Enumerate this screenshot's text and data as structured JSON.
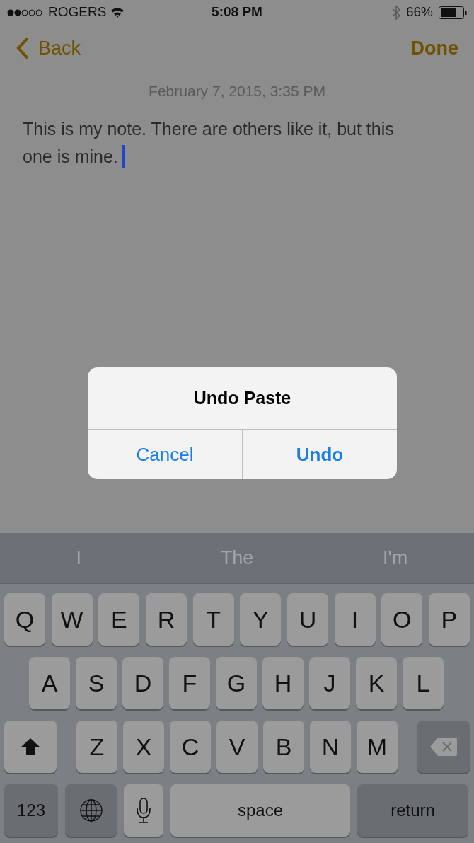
{
  "status_bar": {
    "carrier": "ROGERS",
    "time": "5:08 PM",
    "battery": "66%"
  },
  "nav": {
    "back": "Back",
    "done": "Done"
  },
  "note": {
    "date": "February 7, 2015, 3:35 PM",
    "lines": [
      "This is my note. There are others like it, but this",
      "one is mine."
    ]
  },
  "alert": {
    "title": "Undo Paste",
    "buttons": [
      {
        "label": "Cancel",
        "primary": false
      },
      {
        "label": "Undo",
        "primary": true
      }
    ]
  },
  "suggestions": [
    "I",
    "The",
    "I'm"
  ],
  "keyboard": {
    "rows": [
      {
        "keys": [
          {
            "kind": "letter",
            "label": "Q"
          },
          {
            "kind": "letter",
            "label": "W"
          },
          {
            "kind": "letter",
            "label": "E"
          },
          {
            "kind": "letter",
            "label": "R"
          },
          {
            "kind": "letter",
            "label": "T"
          },
          {
            "kind": "letter",
            "label": "Y"
          },
          {
            "kind": "letter",
            "label": "U"
          },
          {
            "kind": "letter",
            "label": "I"
          },
          {
            "kind": "letter",
            "label": "O"
          },
          {
            "kind": "letter",
            "label": "P"
          }
        ]
      },
      {
        "keys": [
          {
            "kind": "letter",
            "label": "A"
          },
          {
            "kind": "letter",
            "label": "S"
          },
          {
            "kind": "letter",
            "label": "D"
          },
          {
            "kind": "letter",
            "label": "F"
          },
          {
            "kind": "letter",
            "label": "G"
          },
          {
            "kind": "letter",
            "label": "H"
          },
          {
            "kind": "letter",
            "label": "J"
          },
          {
            "kind": "letter",
            "label": "K"
          },
          {
            "kind": "letter",
            "label": "L"
          }
        ]
      },
      {
        "keys": [
          {
            "kind": "shift"
          },
          {
            "kind": "letter",
            "label": "Z"
          },
          {
            "kind": "letter",
            "label": "X"
          },
          {
            "kind": "letter",
            "label": "C"
          },
          {
            "kind": "letter",
            "label": "V"
          },
          {
            "kind": "letter",
            "label": "B"
          },
          {
            "kind": "letter",
            "label": "N"
          },
          {
            "kind": "letter",
            "label": "M"
          },
          {
            "kind": "delete"
          }
        ]
      },
      {
        "keys": [
          {
            "kind": "numbers",
            "label": "123"
          },
          {
            "kind": "globe"
          },
          {
            "kind": "mic"
          },
          {
            "kind": "space",
            "label": "space"
          },
          {
            "kind": "return",
            "label": "return"
          }
        ]
      }
    ]
  }
}
